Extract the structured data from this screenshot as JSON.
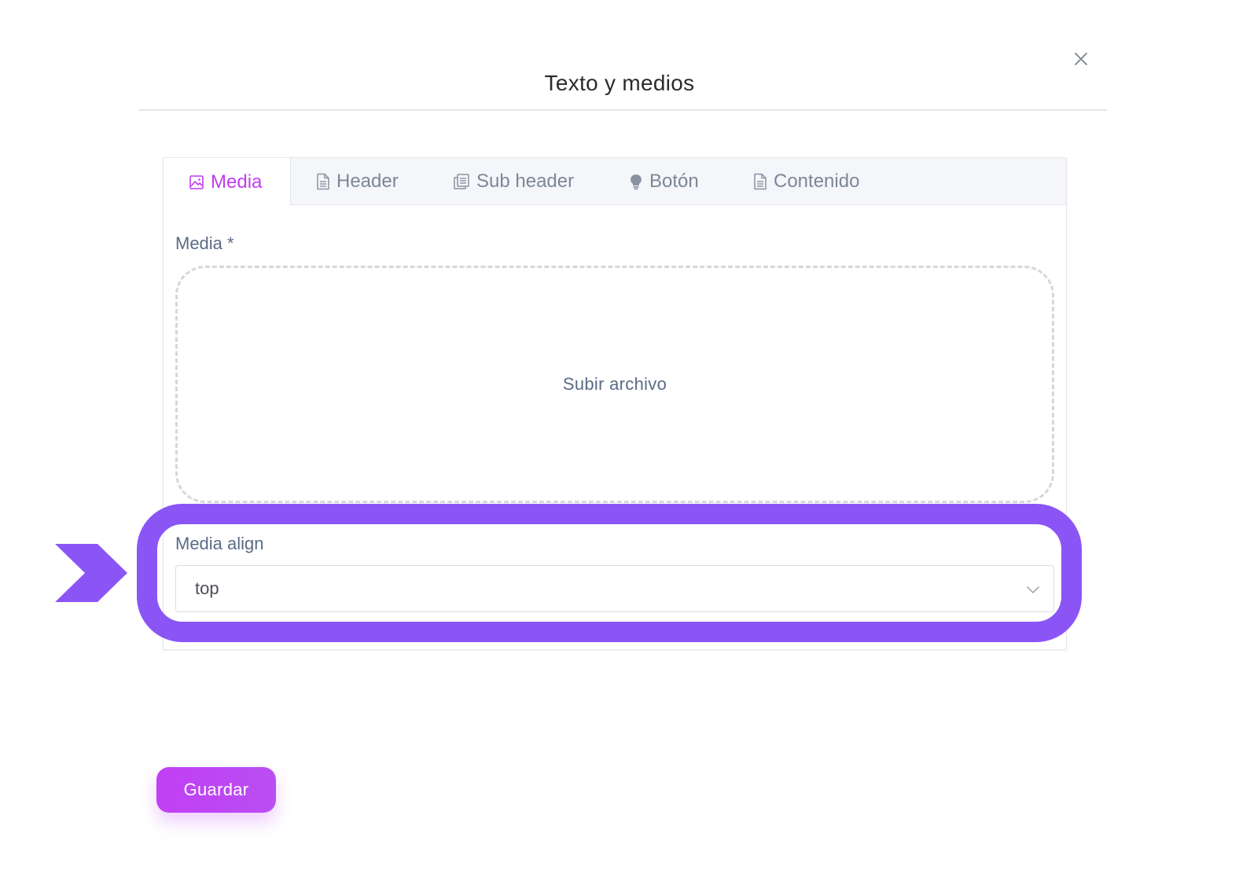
{
  "modal": {
    "title": "Texto y medios"
  },
  "tabs": [
    {
      "label": "Media",
      "icon": "image-icon",
      "active": true
    },
    {
      "label": "Header",
      "icon": "document-icon",
      "active": false
    },
    {
      "label": "Sub header",
      "icon": "documents-icon",
      "active": false
    },
    {
      "label": "Botón",
      "icon": "lightbulb-icon",
      "active": false
    },
    {
      "label": "Contenido",
      "icon": "document-icon",
      "active": false
    }
  ],
  "form": {
    "media_label": "Media *",
    "upload_text": "Subir archivo",
    "align_label": "Media align",
    "align_value": "top"
  },
  "footer": {
    "save_label": "Guardar"
  },
  "colors": {
    "accent": "#c23cf0",
    "highlight": "#8b55f6",
    "label": "#5a6b86"
  }
}
